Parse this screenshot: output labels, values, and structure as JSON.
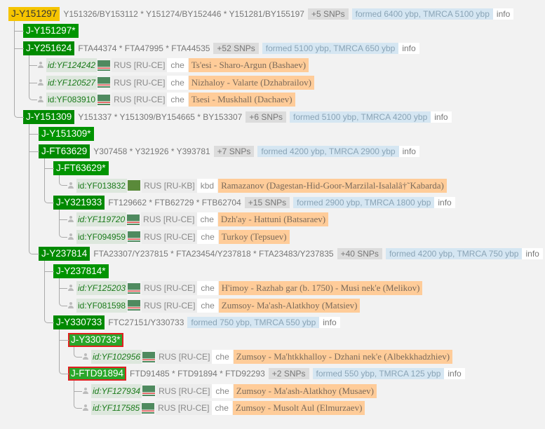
{
  "colors": {
    "root": "#f5c400",
    "clade": "#008a00",
    "selected_border": "#e02020",
    "name_bg": "#ffcc99",
    "age_bg": "#d5e6f2"
  },
  "tree": {
    "type": "clade",
    "label": "J-Y151297",
    "style": "root",
    "snps": "Y151326/BY153112 * Y151274/BY152446 * Y151281/BY155197",
    "more": "+5 SNPs",
    "age": "formed 6400 ybp, TMRCA 5100 ybp",
    "info": "info",
    "children": [
      {
        "type": "clade",
        "label": "J-Y151297*",
        "style": "star"
      },
      {
        "type": "clade",
        "label": "J-Y251624",
        "snps": "FTA44374 * FTA47995 * FTA44535",
        "more": "+52 SNPs",
        "age": "formed 5100 ybp, TMRCA 650 ybp",
        "info": "info",
        "children": [
          {
            "type": "sample",
            "id": "id:YF124242",
            "italic": true,
            "flag": "che",
            "country": "RUS [RU-CE]",
            "lang": "che",
            "name": "Ts'esi - Sharo-Argun (Bashaev)"
          },
          {
            "type": "sample",
            "id": "id:YF120527",
            "italic": true,
            "flag": "che",
            "country": "RUS [RU-CE]",
            "lang": "che",
            "name": "Nizhaloy - Valarte (Dzhabrailov)"
          },
          {
            "type": "sample",
            "id": "id:YF083910",
            "italic": false,
            "flag": "che",
            "country": "RUS [RU-CE]",
            "lang": "che",
            "name": "Tsesi - Muskhall (Dachaev)"
          }
        ]
      },
      {
        "type": "clade",
        "label": "J-Y151309",
        "snps": "Y151337 * Y151309/BY154665 * BY153307",
        "more": "+6 SNPs",
        "age": "formed 5100 ybp, TMRCA 4200 ybp",
        "info": "info",
        "children": [
          {
            "type": "clade",
            "label": "J-Y151309*",
            "style": "star"
          },
          {
            "type": "clade",
            "label": "J-FT63629",
            "snps": "Y307458 * Y321926 * Y393781",
            "more": "+7 SNPs",
            "age": "formed 4200 ybp, TMRCA 2900 ybp",
            "info": "info",
            "children": [
              {
                "type": "clade",
                "label": "J-FT63629*",
                "style": "star",
                "children": [
                  {
                    "type": "sample",
                    "id": "id:YF013832",
                    "italic": false,
                    "flag": "kb",
                    "country": "RUS [RU-KB]",
                    "lang": "kbd",
                    "name": "Ramazanov (Dagestan-Hid-Goor-Marzilal-Isalalâ†˜Kabarda)"
                  }
                ]
              },
              {
                "type": "clade",
                "label": "J-Y321933",
                "snps": "FT129662 * FTB62729 * FTB62704",
                "more": "+15 SNPs",
                "age": "formed 2900 ybp, TMRCA 1800 ybp",
                "info": "info",
                "children": [
                  {
                    "type": "sample",
                    "id": "id:YF119720",
                    "italic": true,
                    "flag": "che",
                    "country": "RUS [RU-CE]",
                    "lang": "che",
                    "name": "Dzh'ay - Hattuni (Batsaraev)"
                  },
                  {
                    "type": "sample",
                    "id": "id:YF094959",
                    "italic": false,
                    "flag": "che",
                    "country": "RUS [RU-CE]",
                    "lang": "che",
                    "name": "Turkoy (Tepsuev)"
                  }
                ]
              }
            ]
          },
          {
            "type": "clade",
            "label": "J-Y237814",
            "snps": "FTA23307/Y237815 * FTA23454/Y237818 * FTA23483/Y237835",
            "more": "+40 SNPs",
            "age": "formed 4200 ybp, TMRCA 750 ybp",
            "info": "info",
            "children": [
              {
                "type": "clade",
                "label": "J-Y237814*",
                "style": "star",
                "children": [
                  {
                    "type": "sample",
                    "id": "id:YF125203",
                    "italic": true,
                    "flag": "che",
                    "country": "RUS [RU-CE]",
                    "lang": "che",
                    "name": "H'imoy - Razhab gar (b. 1750) - Musi nek'e (Melikov)"
                  },
                  {
                    "type": "sample",
                    "id": "id:YF081598",
                    "italic": false,
                    "flag": "che",
                    "country": "RUS [RU-CE]",
                    "lang": "che",
                    "name": "Zumsoy- Ma'ash-Alatkhoy (Matsiev)"
                  }
                ]
              },
              {
                "type": "clade",
                "label": "J-Y330733",
                "snps": "FTC27151/Y330733",
                "age": "formed 750 ybp, TMRCA 550 ybp",
                "info": "info",
                "children": [
                  {
                    "type": "clade",
                    "label": "J-Y330733*",
                    "style": "sel",
                    "children": [
                      {
                        "type": "sample",
                        "id": "id:YF102956",
                        "italic": true,
                        "flag": "che",
                        "country": "RUS [RU-CE]",
                        "lang": "che",
                        "name": "Zumsoy - Ma'htkkhalloy - Dzhani nek'e (Albekkhadzhiev)"
                      }
                    ]
                  },
                  {
                    "type": "clade",
                    "label": "J-FTD91894",
                    "style": "sel",
                    "snps": "FTD91485 * FTD91894 * FTD92293",
                    "more": "+2 SNPs",
                    "age": "formed 550 ybp, TMRCA 125 ybp",
                    "info": "info",
                    "children": [
                      {
                        "type": "sample",
                        "id": "id:YF127934",
                        "italic": true,
                        "flag": "che",
                        "country": "RUS [RU-CE]",
                        "lang": "che",
                        "name": "Zumsoy - Ma'ash-Alatkhoy (Musaev)"
                      },
                      {
                        "type": "sample",
                        "id": "id:YF117585",
                        "italic": true,
                        "flag": "che",
                        "country": "RUS [RU-CE]",
                        "lang": "che",
                        "name": "Zumsoy - Musolt Aul (Elmurzaev)"
                      }
                    ]
                  }
                ]
              }
            ]
          }
        ]
      }
    ]
  }
}
